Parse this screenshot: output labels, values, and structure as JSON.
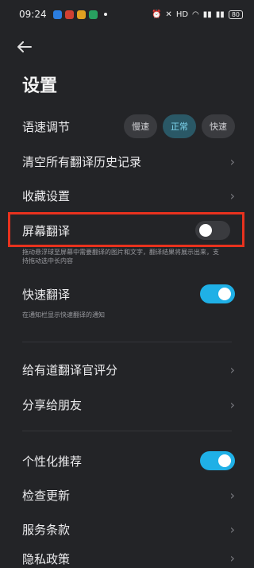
{
  "status_bar": {
    "time": "09:24",
    "app_icons": [
      "#e3392b",
      "#d04032",
      "#e0a020",
      "#28a060"
    ],
    "battery": "80"
  },
  "page_title": "设置",
  "speech_rate": {
    "label": "语速调节",
    "options": [
      "慢速",
      "正常",
      "快速"
    ],
    "selected": "正常"
  },
  "clear_history_label": "清空所有翻译历史记录",
  "favorites_label": "收藏设置",
  "screen_translate": {
    "label": "屏幕翻译",
    "enabled": false,
    "desc": "拖动悬浮球至屏幕中需要翻译的图片和文字，翻译结果将展示出来，支持拖动选中长内容"
  },
  "quick_translate": {
    "label": "快速翻译",
    "enabled": true,
    "desc": "在通知栏显示快速翻译的通知"
  },
  "rate_label": "给有道翻译官评分",
  "share_label": "分享给朋友",
  "personalized": {
    "label": "个性化推荐",
    "enabled": true
  },
  "check_update_label": "检查更新",
  "terms_label": "服务条款",
  "privacy_label": "隐私政策",
  "colors": {
    "background": "#232427",
    "toggle_on": "#1fb0e6",
    "highlight": "#e8321e"
  }
}
